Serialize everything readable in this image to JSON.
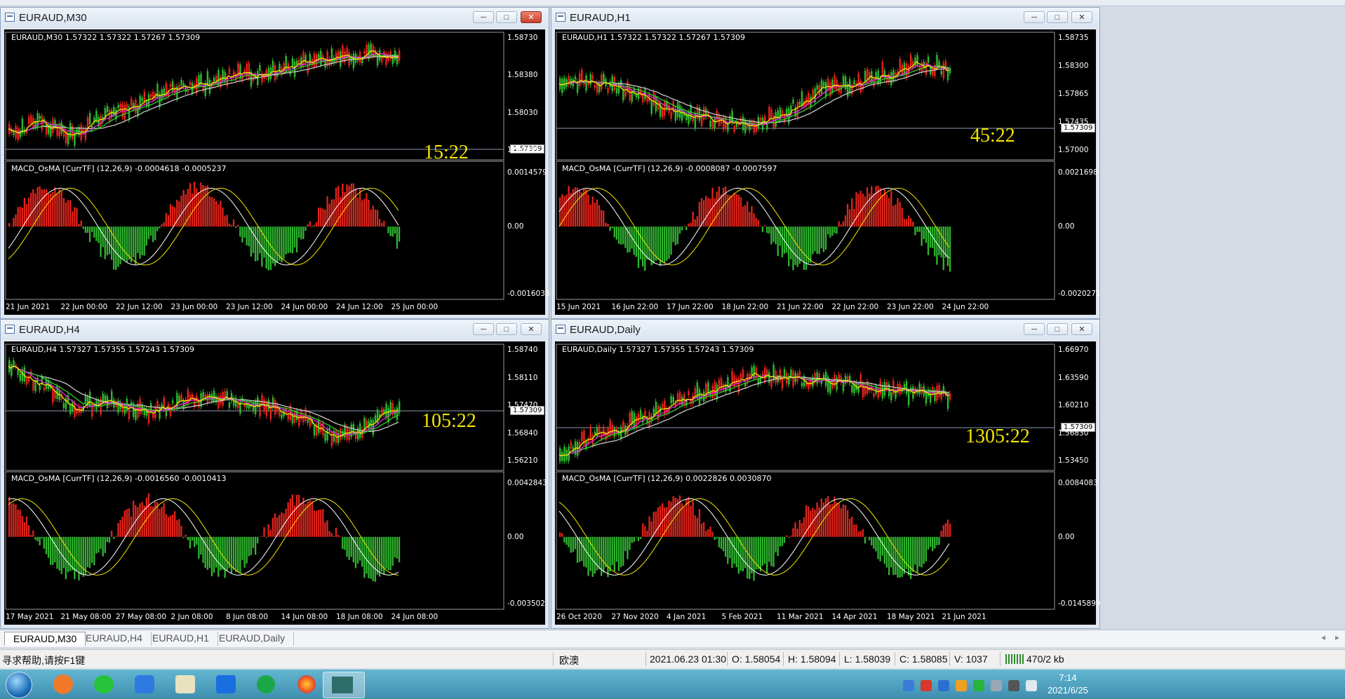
{
  "windows": [
    {
      "key": "m30",
      "title": "EURAUD,M30",
      "ohlc": "EURAUD,M30  1.57322 1.57322 1.57267 1.57309",
      "indicator": "MACD_OsMA [CurrTF] (12,26,9) -0.0004618 -0.0005237",
      "timer": "15:22",
      "price_tag": "1.57309",
      "price_levels": [
        "1.58730",
        "1.58380",
        "1.58030",
        "1.57680"
      ],
      "macd_levels": [
        "0.0014579",
        "0.00",
        "-0.0016033"
      ],
      "time_labels": [
        "21 Jun 2021",
        "22 Jun 00:00",
        "22 Jun 12:00",
        "23 Jun 00:00",
        "23 Jun 12:00",
        "24 Jun 00:00",
        "24 Jun 12:00",
        "25 Jun 00:00"
      ]
    },
    {
      "key": "h1",
      "title": "EURAUD,H1",
      "ohlc": "EURAUD,H1  1.57322 1.57322 1.57267 1.57309",
      "indicator": "MACD_OsMA [CurrTF] (12,26,9) -0.0008087 -0.0007597",
      "timer": "45:22",
      "price_tag": "1.57309",
      "price_levels": [
        "1.58735",
        "1.58300",
        "1.57865",
        "1.57435",
        "1.57000"
      ],
      "macd_levels": [
        "0.0021698",
        "0.00",
        "-0.0020271"
      ],
      "time_labels": [
        "15 Jun 2021",
        "16 Jun 22:00",
        "17 Jun 22:00",
        "18 Jun 22:00",
        "21 Jun 22:00",
        "22 Jun 22:00",
        "23 Jun 22:00",
        "24 Jun 22:00"
      ]
    },
    {
      "key": "h4",
      "title": "EURAUD,H4",
      "ohlc": "EURAUD,H4  1.57327 1.57355 1.57243 1.57309",
      "indicator": "MACD_OsMA [CurrTF] (12,26,9) -0.0016560 -0.0010413",
      "timer": "105:22",
      "price_tag": "1.57309",
      "price_levels": [
        "1.58740",
        "1.58110",
        "1.57470",
        "1.56840",
        "1.56210"
      ],
      "macd_levels": [
        "0.0042843",
        "0.00",
        "-0.003502"
      ],
      "time_labels": [
        "17 May 2021",
        "21 May 08:00",
        "27 May 08:00",
        "2 Jun 08:00",
        "8 Jun 08:00",
        "14 Jun 08:00",
        "18 Jun 08:00",
        "24 Jun 08:00"
      ]
    },
    {
      "key": "daily",
      "title": "EURAUD,Daily",
      "ohlc": "EURAUD,Daily  1.57327 1.57355 1.57243 1.57309",
      "indicator": "MACD_OsMA [CurrTF] (12,26,9) 0.0022826 0.0030870",
      "timer": "1305:22",
      "price_tag": "1.57309",
      "price_levels": [
        "1.66970",
        "1.63590",
        "1.60210",
        "1.56830",
        "1.53450"
      ],
      "macd_levels": [
        "0.0084083",
        "0.00",
        "-0.0145899"
      ],
      "time_labels": [
        "26 Oct 2020",
        "27 Nov 2020",
        "4 Jan 2021",
        "5 Feb 2021",
        "11 Mar 2021",
        "14 Apr 2021",
        "18 May 2021",
        "21 Jun 2021"
      ]
    }
  ],
  "window_buttons": {
    "minimize": "─",
    "maximize": "□",
    "close": "✕"
  },
  "tabs": [
    "EURAUD,M30",
    "EURAUD,H4",
    "EURAUD,H1",
    "EURAUD,Daily"
  ],
  "tab_scroll": {
    "left": "◂",
    "right": "▸"
  },
  "status": {
    "help": "寻求帮助,请按F1键",
    "profile": "欧澳",
    "datetime": "2021.06.23 01:30",
    "open": "O: 1.58054",
    "high": "H: 1.58094",
    "low": "L: 1.58039",
    "close": "C: 1.58085",
    "volume": "V: 1037",
    "traffic": "470/2 kb"
  },
  "clock": {
    "time": "7:14",
    "date": "2021/6/25"
  },
  "colors": {
    "bull": "#e2231a",
    "bear": "#2fb52f",
    "ma_fast": "#f2e600",
    "ma_mid": "#e22be2",
    "ma_slow": "#33cc33",
    "ma_long": "#c8c8c8",
    "timer": "#f2e600"
  }
}
